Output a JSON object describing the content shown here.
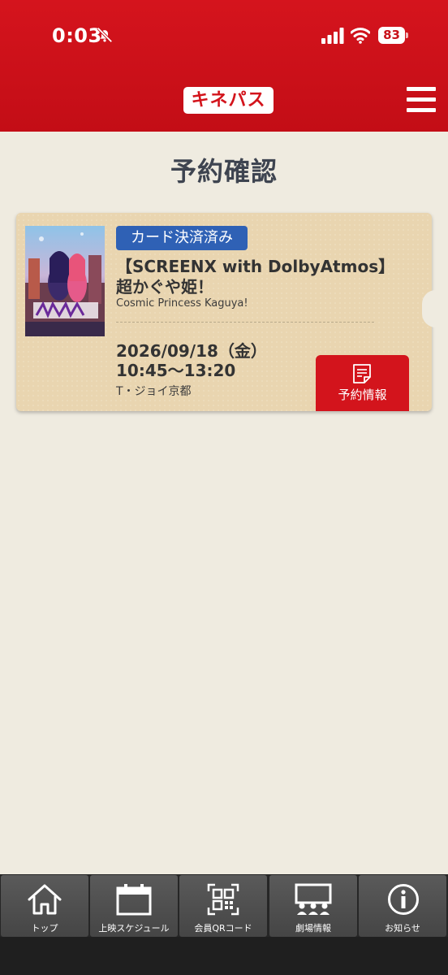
{
  "status_bar": {
    "time": "0:03",
    "battery": "83"
  },
  "header": {
    "logo": "キネパス"
  },
  "page": {
    "title": "予約確認"
  },
  "reservation": {
    "badge": "カード決済済み",
    "title": "【SCREENX with DolbyAtmos】超かぐや姫！",
    "subtitle": "Cosmic Princess Kaguya!",
    "date": "2026/09/18（金）",
    "time": "10:45〜13:20",
    "theater": "T・ジョイ京都",
    "detail_button": "予約情報"
  },
  "tabs": [
    {
      "label": "トップ",
      "icon": "home-icon"
    },
    {
      "label": "上映スケジュール",
      "icon": "calendar-icon"
    },
    {
      "label": "会員QRコード",
      "icon": "qr-code-icon"
    },
    {
      "label": "劇場情報",
      "icon": "theater-icon"
    },
    {
      "label": "お知らせ",
      "icon": "info-icon"
    }
  ],
  "colors": {
    "brand_red": "#c8111a",
    "badge_blue": "#2f61b5",
    "ticket": "#e9d5b0",
    "background": "#efebe0"
  }
}
